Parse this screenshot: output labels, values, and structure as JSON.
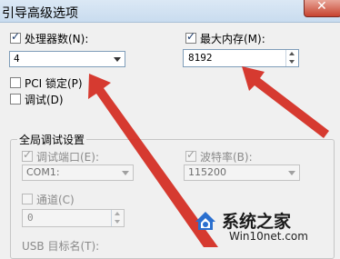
{
  "window": {
    "title": "引导高级选项",
    "close_glyph": "✕"
  },
  "processors": {
    "label": "处理器数(N):",
    "checked": true,
    "value": "4"
  },
  "max_memory": {
    "label": "最大内存(M):",
    "checked": true,
    "value": "8192"
  },
  "pci_lock": {
    "label": "PCI 锁定(P)",
    "checked": false
  },
  "debug": {
    "label": "调试(D)",
    "checked": false
  },
  "global_debug": {
    "title": "全局调试设置",
    "debug_port": {
      "label": "调试端口(E):",
      "checked": true,
      "value": "COM1:"
    },
    "baud_rate": {
      "label": "波特率(B):",
      "checked": true,
      "value": "115200"
    },
    "channel": {
      "label": "通道(C)",
      "checked": false,
      "value": "0"
    },
    "usb_target": {
      "label": "USB 目标名(T):"
    }
  },
  "watermark": {
    "brand": "系统之家",
    "url": "Win10net.com"
  },
  "colors": {
    "arrow": "#d42a1f",
    "title_bar": "#c9dcef",
    "background": "#f0f0f0"
  }
}
